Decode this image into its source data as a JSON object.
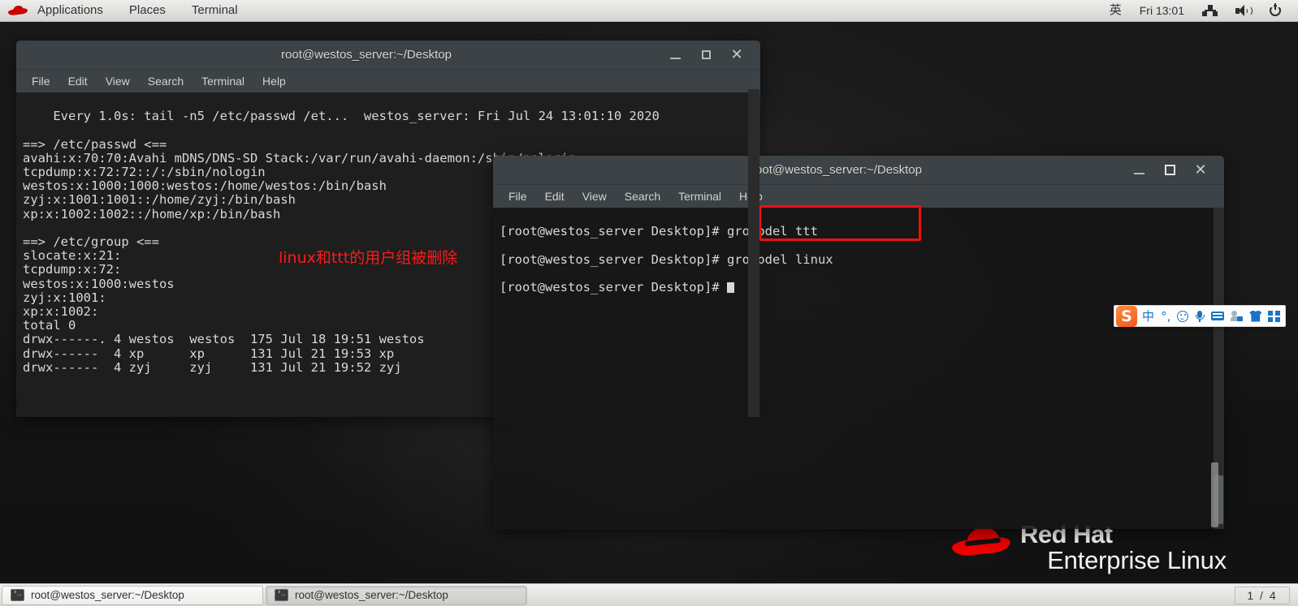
{
  "top_panel": {
    "logo_icon": "redhat-hat-icon",
    "menus": [
      "Applications",
      "Places",
      "Terminal"
    ],
    "tray": {
      "ime_indicator": "英",
      "clock": "Fri 13:01",
      "network_icon": "network-icon",
      "volume_icon": "volume-icon",
      "power_icon": "power-icon"
    }
  },
  "window1": {
    "title": "root@westos_server:~/Desktop",
    "menus": [
      "File",
      "Edit",
      "View",
      "Search",
      "Terminal",
      "Help"
    ],
    "buttons": {
      "minimize": "minimize-button",
      "maximize": "maximize-button",
      "close": "close-button"
    },
    "content": "Every 1.0s: tail -n5 /etc/passwd /et...  westos_server: Fri Jul 24 13:01:10 2020\n\n==> /etc/passwd <==\navahi:x:70:70:Avahi mDNS/DNS-SD Stack:/var/run/avahi-daemon:/sbin/nologin\ntcpdump:x:72:72::/:/sbin/nologin\nwestos:x:1000:1000:westos:/home/westos:/bin/bash\nzyj:x:1001:1001::/home/zyj:/bin/bash\nxp:x:1002:1002::/home/xp:/bin/bash\n\n==> /etc/group <==\nslocate:x:21:\ntcpdump:x:72:\nwestos:x:1000:westos\nzyj:x:1001:\nxp:x:1002:\ntotal 0\ndrwx------. 4 westos  westos  175 Jul 18 19:51 westos\ndrwx------  4 xp      xp      131 Jul 21 19:53 xp\ndrwx------  4 zyj     zyj     131 Jul 21 19:52 zyj"
  },
  "window2": {
    "title": "root@westos_server:~/Desktop",
    "menus": [
      "File",
      "Edit",
      "View",
      "Search",
      "Terminal",
      "Help"
    ],
    "buttons": {
      "minimize": "minimize-button",
      "maximize": "maximize-button",
      "close": "close-button"
    },
    "lines": [
      {
        "prompt": "[root@westos_server Desktop]# ",
        "command": "groupdel ttt"
      },
      {
        "prompt": "[root@westos_server Desktop]# ",
        "command": "groupdel linux"
      },
      {
        "prompt": "[root@westos_server Desktop]# ",
        "command": ""
      }
    ]
  },
  "annotation": {
    "text": "linux和ttt的用户组被删除",
    "color": "#ff1a1a",
    "highlight_box_color": "#ee1111"
  },
  "branding": {
    "line1": "Red Hat",
    "line2": "Enterprise Linux",
    "logo_icon": "redhat-hat-icon"
  },
  "ime_toolbar": {
    "logo": "S",
    "items": [
      "mode-chinese-label",
      "punctuation-icon",
      "emoji-icon",
      "voice-input-icon",
      "soft-keyboard-icon",
      "user-profile-icon",
      "skin-icon",
      "toolbox-icon"
    ],
    "mode_label": "中",
    "punctuation_label": "°,"
  },
  "taskbar": {
    "tasks": [
      {
        "icon": "terminal-icon",
        "label": "root@westos_server:~/Desktop",
        "active": false
      },
      {
        "icon": "terminal-icon",
        "label": "root@westos_server:~/Desktop",
        "active": true
      }
    ],
    "pager": "1 / 4"
  }
}
